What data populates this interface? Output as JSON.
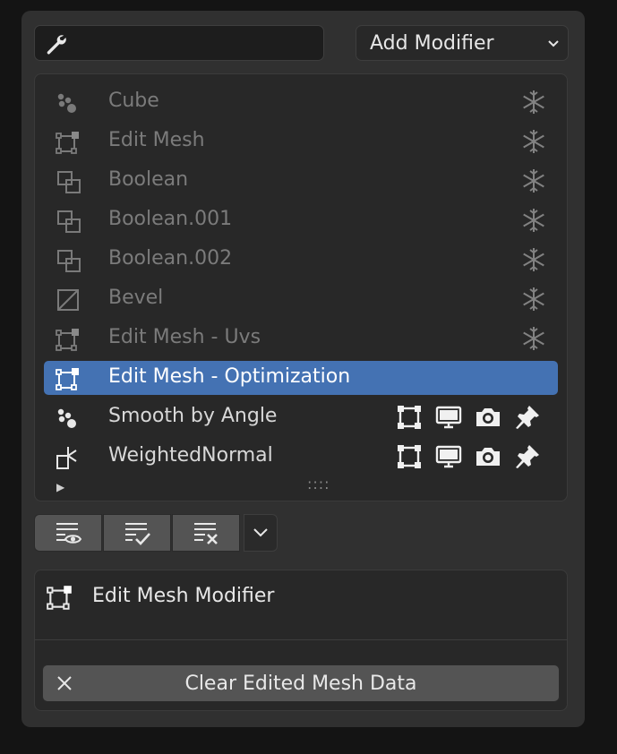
{
  "search": {
    "icon": "wrench-icon",
    "value": ""
  },
  "add_modifier": {
    "label": "Add Modifier",
    "icon": "chevron-down-icon"
  },
  "modifiers": [
    {
      "name": "Cube",
      "icon": "geometry-nodes-icon",
      "state": "disabled"
    },
    {
      "name": "Edit Mesh",
      "icon": "edit-mesh-icon",
      "state": "disabled"
    },
    {
      "name": "Boolean",
      "icon": "boolean-icon",
      "state": "disabled"
    },
    {
      "name": "Boolean.001",
      "icon": "boolean-icon",
      "state": "disabled"
    },
    {
      "name": "Boolean.002",
      "icon": "boolean-icon",
      "state": "disabled"
    },
    {
      "name": "Bevel",
      "icon": "bevel-icon",
      "state": "disabled"
    },
    {
      "name": "Edit Mesh - Uvs",
      "icon": "edit-mesh-icon",
      "state": "disabled"
    },
    {
      "name": "Edit Mesh - Optimization",
      "icon": "edit-mesh-icon",
      "state": "active"
    },
    {
      "name": "Smooth by Angle",
      "icon": "geometry-nodes-icon",
      "state": "enabled"
    },
    {
      "name": "WeightedNormal",
      "icon": "weighted-normal-icon",
      "state": "enabled"
    }
  ],
  "colors": {
    "active_row": "#4472b3",
    "panel": "#303030",
    "list_bg": "#282828"
  },
  "toolbar": {
    "buttons": [
      "show-modifiers-icon",
      "apply-modifiers-icon",
      "remove-modifiers-icon"
    ],
    "dropdown_icon": "chevron-down-icon"
  },
  "detail": {
    "title": "Edit Mesh Modifier",
    "icon": "edit-mesh-icon",
    "clear_label": "Clear Edited Mesh Data",
    "clear_icon": "close-icon"
  }
}
